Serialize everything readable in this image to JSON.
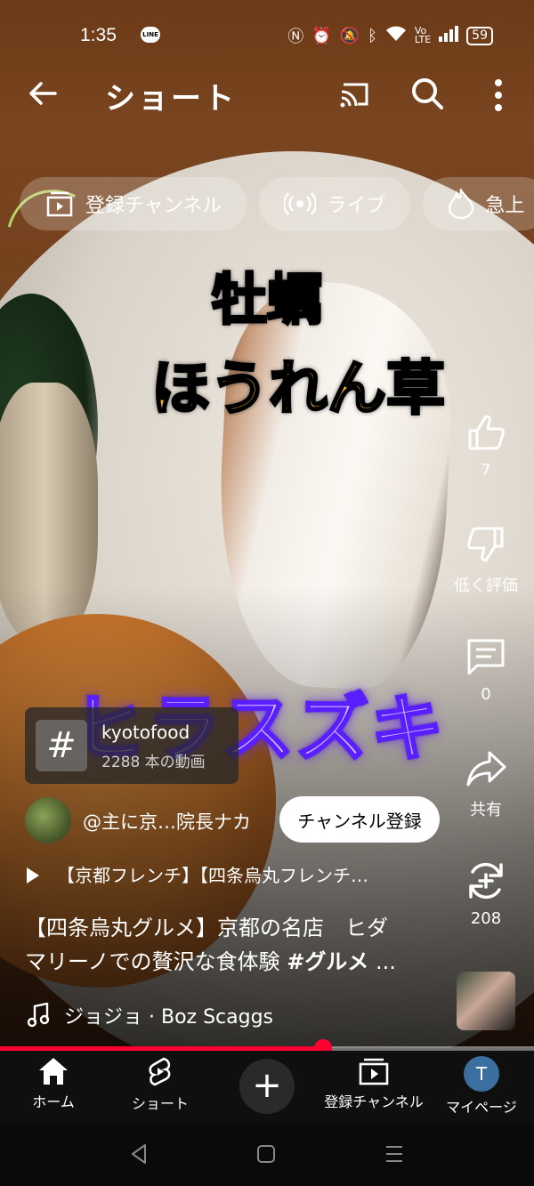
{
  "status_bar": {
    "time": "1:35",
    "battery": "59",
    "line_label": "LINE"
  },
  "header": {
    "title": "ショート"
  },
  "chips": [
    {
      "icon": "subscriptions-icon",
      "label": "登録チャンネル"
    },
    {
      "icon": "live-icon",
      "label": "ライブ"
    },
    {
      "icon": "trending-icon",
      "label": "急上"
    }
  ],
  "overlay": {
    "line1": "牡蠣",
    "line2": "ほうれん草",
    "line3": "ヒラスズキ"
  },
  "actions": {
    "like_count": "7",
    "dislike_label": "低く評価",
    "comment_count": "0",
    "share_label": "共有",
    "remix_count": "208"
  },
  "hashtag": {
    "symbol": "#",
    "name": "kyotofood",
    "count": "2288 本の動画"
  },
  "channel": {
    "name": "@主に京…院長ナカ",
    "subscribe_label": "チャンネル登録"
  },
  "playlist": {
    "title": "【京都フレンチ】【四条烏丸フレンチ…"
  },
  "description": {
    "line1": "【四条烏丸グルメ】京都の名店　ヒダ",
    "line2_prefix": "マリーノでの贅沢な食体験 ",
    "line2_tag": "#グルメ",
    "line2_suffix": " ..."
  },
  "music": {
    "label": "ジョジョ · Boz Scaggs"
  },
  "progress": {
    "fraction": 0.605
  },
  "nav": {
    "home": "ホーム",
    "shorts": "ショート",
    "create": "+",
    "subscriptions": "登録チャンネル",
    "my_page": "マイページ",
    "avatar_letter": "T"
  },
  "colors": {
    "accent": "#ff0033",
    "overlay_yellow": "#f7c21a",
    "overlay_purple": "#6c2cff"
  }
}
